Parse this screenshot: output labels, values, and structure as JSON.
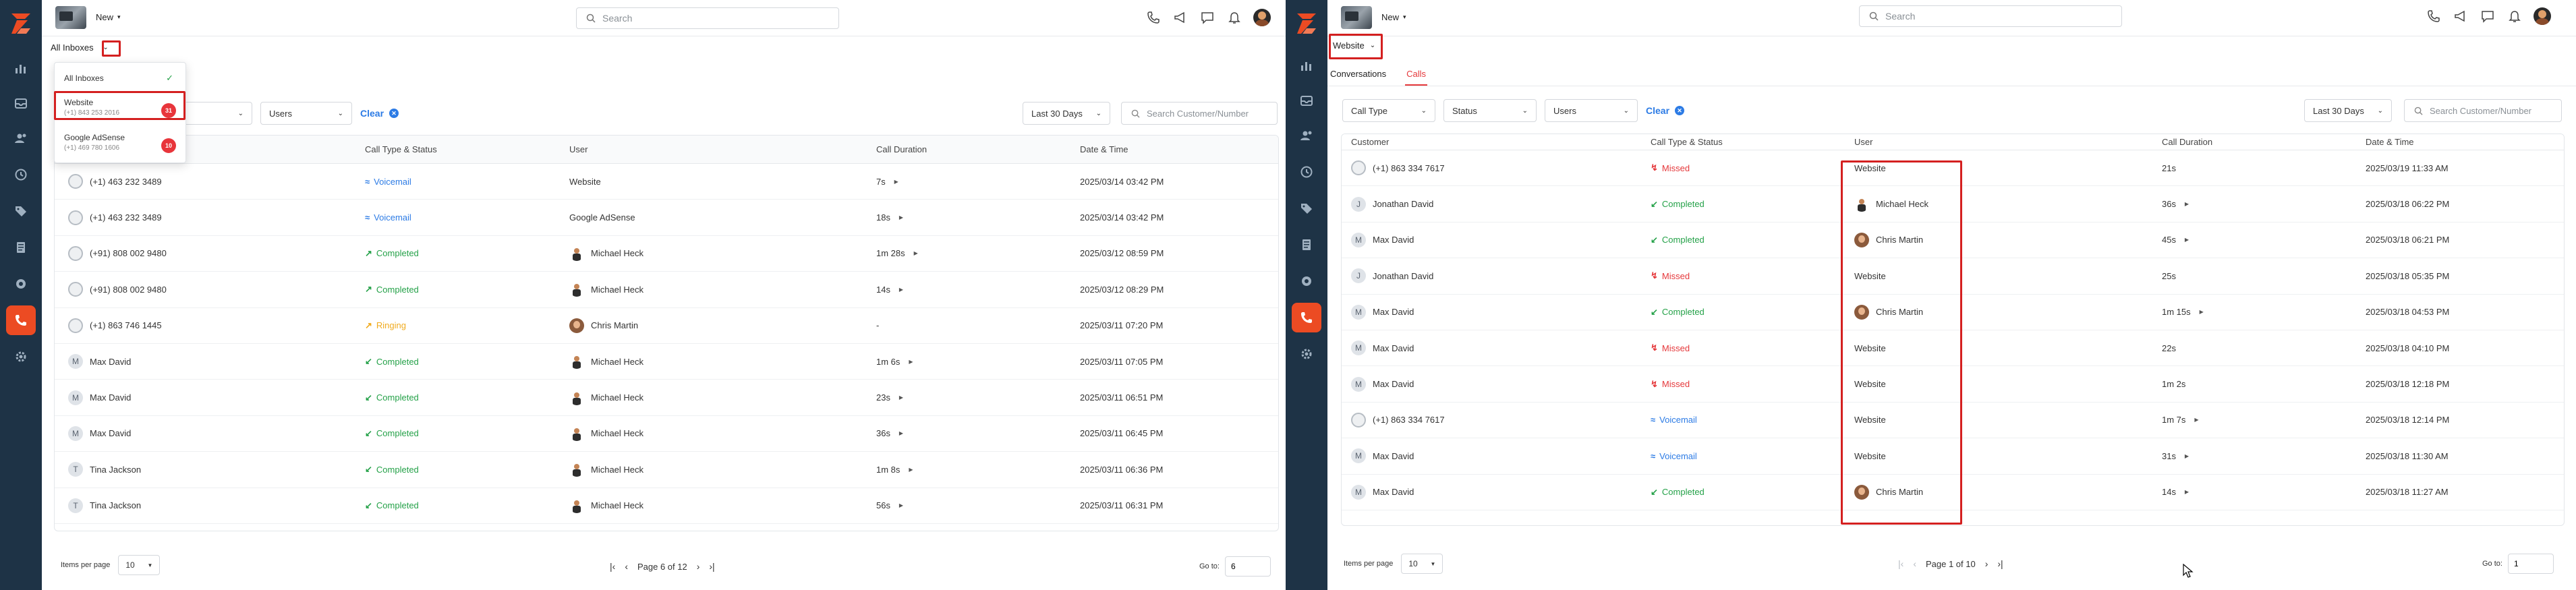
{
  "left": {
    "topbar": {
      "new_label": "New",
      "search_placeholder": "Search"
    },
    "inbox_label": "All Inboxes",
    "dropdown": {
      "items": [
        {
          "name": "All Inboxes",
          "phone": "",
          "badge": ""
        },
        {
          "name": "Website",
          "phone": "(+1) 843 253 2016",
          "badge": "31"
        },
        {
          "name": "Google AdSense",
          "phone": "(+1) 469 780 1606",
          "badge": "10"
        }
      ]
    },
    "filters": {
      "users": "Users",
      "clear": "Clear",
      "date_range": "Last 30 Days",
      "search_placeholder": "Search Customer/Number"
    },
    "columns": [
      "",
      "Call Type & Status",
      "User",
      "Call Duration",
      "Date & Time"
    ],
    "rows": [
      {
        "customer": "(+1) 463 232 3489",
        "avatar": "ph",
        "status": "Voicemail",
        "status_color": "#2c7be5",
        "arrow": "≈",
        "user": "Website",
        "user_avatar": "",
        "duration": "7s",
        "play": true,
        "datetime": "2025/03/14 03:42 PM"
      },
      {
        "customer": "(+1) 463 232 3489",
        "avatar": "ph",
        "status": "Voicemail",
        "status_color": "#2c7be5",
        "arrow": "≈",
        "user": "Google AdSense",
        "user_avatar": "",
        "duration": "18s",
        "play": true,
        "datetime": "2025/03/14 03:42 PM"
      },
      {
        "customer": "(+91) 808 002 9480",
        "avatar": "ph",
        "status": "Completed",
        "status_color": "#24a148",
        "arrow": "↗",
        "user": "Michael Heck",
        "user_avatar": "mh",
        "duration": "1m 28s",
        "play": true,
        "datetime": "2025/03/12 08:59 PM"
      },
      {
        "customer": "(+91) 808 002 9480",
        "avatar": "ph",
        "status": "Completed",
        "status_color": "#24a148",
        "arrow": "↗",
        "user": "Michael Heck",
        "user_avatar": "mh",
        "duration": "14s",
        "play": true,
        "datetime": "2025/03/12 08:29 PM"
      },
      {
        "customer": "(+1) 863 746 1445",
        "avatar": "ph",
        "status": "Ringing",
        "status_color": "#f0ab1f",
        "arrow": "↗",
        "user": "Chris Martin",
        "user_avatar": "cm",
        "duration": "-",
        "play": false,
        "datetime": "2025/03/11 07:20 PM"
      },
      {
        "customer": "Max David",
        "avatar": "M",
        "status": "Completed",
        "status_color": "#24a148",
        "arrow": "↙",
        "user": "Michael Heck",
        "user_avatar": "mh",
        "duration": "1m 6s",
        "play": true,
        "datetime": "2025/03/11 07:05 PM"
      },
      {
        "customer": "Max David",
        "avatar": "M",
        "status": "Completed",
        "status_color": "#24a148",
        "arrow": "↙",
        "user": "Michael Heck",
        "user_avatar": "mh",
        "duration": "23s",
        "play": true,
        "datetime": "2025/03/11 06:51 PM"
      },
      {
        "customer": "Max David",
        "avatar": "M",
        "status": "Completed",
        "status_color": "#24a148",
        "arrow": "↙",
        "user": "Michael Heck",
        "user_avatar": "mh",
        "duration": "36s",
        "play": true,
        "datetime": "2025/03/11 06:45 PM"
      },
      {
        "customer": "Tina Jackson",
        "avatar": "T",
        "status": "Completed",
        "status_color": "#24a148",
        "arrow": "↙",
        "user": "Michael Heck",
        "user_avatar": "mh",
        "duration": "1m 8s",
        "play": true,
        "datetime": "2025/03/11 06:36 PM"
      },
      {
        "customer": "Tina Jackson",
        "avatar": "T",
        "status": "Completed",
        "status_color": "#24a148",
        "arrow": "↙",
        "user": "Michael Heck",
        "user_avatar": "mh",
        "duration": "56s",
        "play": true,
        "datetime": "2025/03/11 06:31 PM"
      }
    ],
    "pagination": {
      "items_per_page_label": "Items per page",
      "items_per_page": "10",
      "page_text": "Page 6 of 12",
      "goto_label": "Go to:",
      "goto_value": "6"
    }
  },
  "right": {
    "topbar": {
      "new_label": "New",
      "search_placeholder": "Search"
    },
    "inbox_label": "Website",
    "tabs": [
      "Conversations",
      "Calls"
    ],
    "filters": {
      "call_type": "Call Type",
      "status": "Status",
      "users": "Users",
      "clear": "Clear",
      "date_range": "Last 30 Days",
      "search_placeholder": "Search Customer/Number"
    },
    "columns": [
      "Customer",
      "Call Type & Status",
      "User",
      "Call Duration",
      "Date & Time"
    ],
    "rows": [
      {
        "customer": "(+1) 863 334 7617",
        "avatar": "ph",
        "status": "Missed",
        "status_color": "#e5383b",
        "arrow": "↯",
        "user": "Website",
        "user_avatar": "",
        "duration": "21s",
        "play": false,
        "datetime": "2025/03/19 11:33 AM"
      },
      {
        "customer": "Jonathan David",
        "avatar": "J",
        "status": "Completed",
        "status_color": "#24a148",
        "arrow": "↙",
        "user": "Michael Heck",
        "user_avatar": "mh",
        "duration": "36s",
        "play": true,
        "datetime": "2025/03/18 06:22 PM"
      },
      {
        "customer": "Max David",
        "avatar": "M",
        "status": "Completed",
        "status_color": "#24a148",
        "arrow": "↙",
        "user": "Chris Martin",
        "user_avatar": "cm",
        "duration": "45s",
        "play": true,
        "datetime": "2025/03/18 06:21 PM"
      },
      {
        "customer": "Jonathan David",
        "avatar": "J",
        "status": "Missed",
        "status_color": "#e5383b",
        "arrow": "↯",
        "user": "Website",
        "user_avatar": "",
        "duration": "25s",
        "play": false,
        "datetime": "2025/03/18 05:35 PM"
      },
      {
        "customer": "Max David",
        "avatar": "M",
        "status": "Completed",
        "status_color": "#24a148",
        "arrow": "↙",
        "user": "Chris Martin",
        "user_avatar": "cm",
        "duration": "1m 15s",
        "play": true,
        "datetime": "2025/03/18 04:53 PM"
      },
      {
        "customer": "Max David",
        "avatar": "M",
        "status": "Missed",
        "status_color": "#e5383b",
        "arrow": "↯",
        "user": "Website",
        "user_avatar": "",
        "duration": "22s",
        "play": false,
        "datetime": "2025/03/18 04:10 PM"
      },
      {
        "customer": "Max David",
        "avatar": "M",
        "status": "Missed",
        "status_color": "#e5383b",
        "arrow": "↯",
        "user": "Website",
        "user_avatar": "",
        "duration": "1m 2s",
        "play": false,
        "datetime": "2025/03/18 12:18 PM"
      },
      {
        "customer": "(+1) 863 334 7617",
        "avatar": "ph",
        "status": "Voicemail",
        "status_color": "#2c7be5",
        "arrow": "≈",
        "user": "Website",
        "user_avatar": "",
        "duration": "1m 7s",
        "play": true,
        "datetime": "2025/03/18 12:14 PM"
      },
      {
        "customer": "Max David",
        "avatar": "M",
        "status": "Voicemail",
        "status_color": "#2c7be5",
        "arrow": "≈",
        "user": "Website",
        "user_avatar": "",
        "duration": "31s",
        "play": true,
        "datetime": "2025/03/18 11:30 AM"
      },
      {
        "customer": "Max David",
        "avatar": "M",
        "status": "Completed",
        "status_color": "#24a148",
        "arrow": "↙",
        "user": "Chris Martin",
        "user_avatar": "cm",
        "duration": "14s",
        "play": true,
        "datetime": "2025/03/18 11:27 AM"
      }
    ],
    "pagination": {
      "items_per_page_label": "Items per page",
      "items_per_page": "10",
      "page_text": "Page 1 of 10",
      "goto_label": "Go to:",
      "goto_value": "1"
    }
  },
  "colors": {
    "rail_bg": "#1e3346",
    "brand": "#ec4b23",
    "highlight_box": "#d42020",
    "link": "#2c7be5"
  }
}
